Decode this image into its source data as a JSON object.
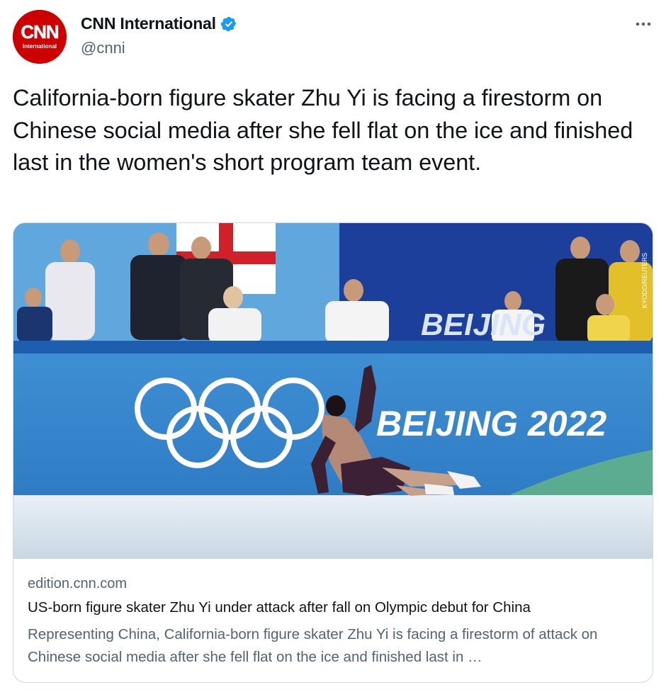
{
  "author": {
    "name": "CNN International",
    "handle": "@cnni",
    "verified": true,
    "avatar_logo_text": "CNN",
    "avatar_sub_text": "International",
    "brand_color": "#cc0000"
  },
  "tweet": {
    "text": "California-born figure skater Zhu Yi is facing a firestorm on Chinese social media after she fell flat on the ice and finished last in the women's short program team event."
  },
  "card": {
    "image": {
      "description_icon": "photo-figure-skater-fall",
      "banner_text": "BEIJING 2022",
      "background_banner_text": "BEIJING",
      "credit": "KYODO/REUTERS"
    },
    "domain": "edition.cnn.com",
    "title": "US-born figure skater Zhu Yi under attack after fall on Olympic debut for China",
    "description": "Representing China, California-born figure skater Zhu Yi is facing a firestorm of attack on Chinese social media after she fell flat on the ice and finished last in …"
  },
  "icons": {
    "more": "more-icon",
    "verified": "verified-badge-icon"
  },
  "colors": {
    "text": "#0f1419",
    "secondary": "#536471",
    "verified": "#1d9bf0",
    "border": "#cfd9de"
  }
}
